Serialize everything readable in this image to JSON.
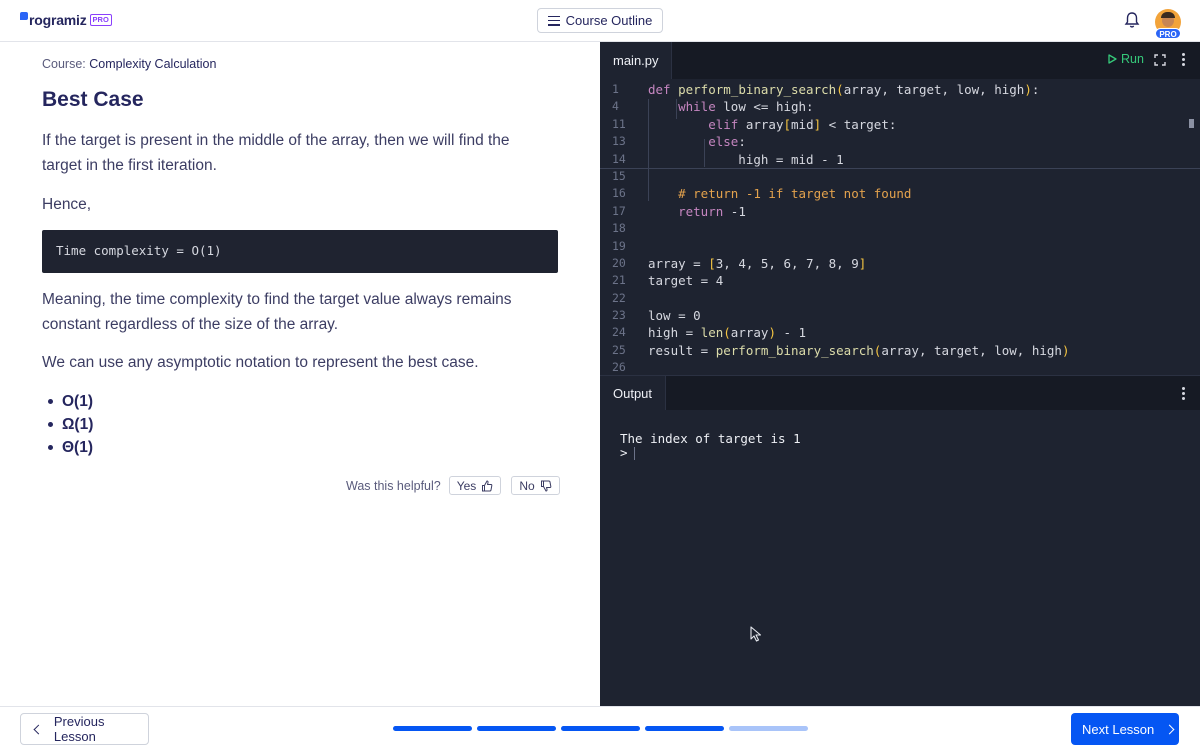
{
  "header": {
    "logo_text": "rogramiz",
    "logo_badge": "PRO",
    "course_outline_label": "Course Outline",
    "avatar_badge": "PRO"
  },
  "lesson": {
    "course_prefix": "Course:",
    "course_name": "Complexity Calculation",
    "title": "Best Case",
    "para1": "If the target is present in the middle of the array, then we will find the target in the first iteration.",
    "para2": "Hence,",
    "code": "Time complexity = O(1)",
    "para3": "Meaning, the time complexity to find the target value always remains constant regardless of the size of the array.",
    "para4": "We can use any asymptotic notation to represent the best case.",
    "bullets": [
      "O(1)",
      "Ω(1)",
      "Θ(1)"
    ],
    "helpful_question": "Was this helpful?",
    "yes_label": "Yes",
    "no_label": "No"
  },
  "editor": {
    "filename": "main.py",
    "run_label": "Run",
    "lines": [
      {
        "num": "1",
        "code": "def perform_binary_search(array, target, low, high):"
      },
      {
        "num": "4",
        "code": "    while low <= high:"
      },
      {
        "num": "11",
        "code": "        elif array[mid] < target:"
      },
      {
        "num": "13",
        "code": "        else:"
      },
      {
        "num": "14",
        "code": "            high = mid - 1"
      },
      {
        "num": "15",
        "code": ""
      },
      {
        "num": "16",
        "code": "    # return -1 if target not found"
      },
      {
        "num": "17",
        "code": "    return -1"
      },
      {
        "num": "18",
        "code": ""
      },
      {
        "num": "19",
        "code": ""
      },
      {
        "num": "20",
        "code": "array = [3, 4, 5, 6, 7, 8, 9]"
      },
      {
        "num": "21",
        "code": "target = 4"
      },
      {
        "num": "22",
        "code": ""
      },
      {
        "num": "23",
        "code": "low = 0"
      },
      {
        "num": "24",
        "code": "high = len(array) - 1"
      },
      {
        "num": "25",
        "code": "result = perform_binary_search(array, target, low, high)"
      },
      {
        "num": "26",
        "code": ""
      }
    ]
  },
  "output": {
    "tab_label": "Output",
    "text": "The index of target is 1",
    "prompt": ">"
  },
  "footer": {
    "prev_label": "Previous Lesson",
    "next_label": "Next Lesson",
    "progress_completed": 4,
    "progress_total": 5
  },
  "colors": {
    "accent": "#0556f3",
    "run_green": "#36c97a",
    "editor_bg": "#1e2330"
  }
}
